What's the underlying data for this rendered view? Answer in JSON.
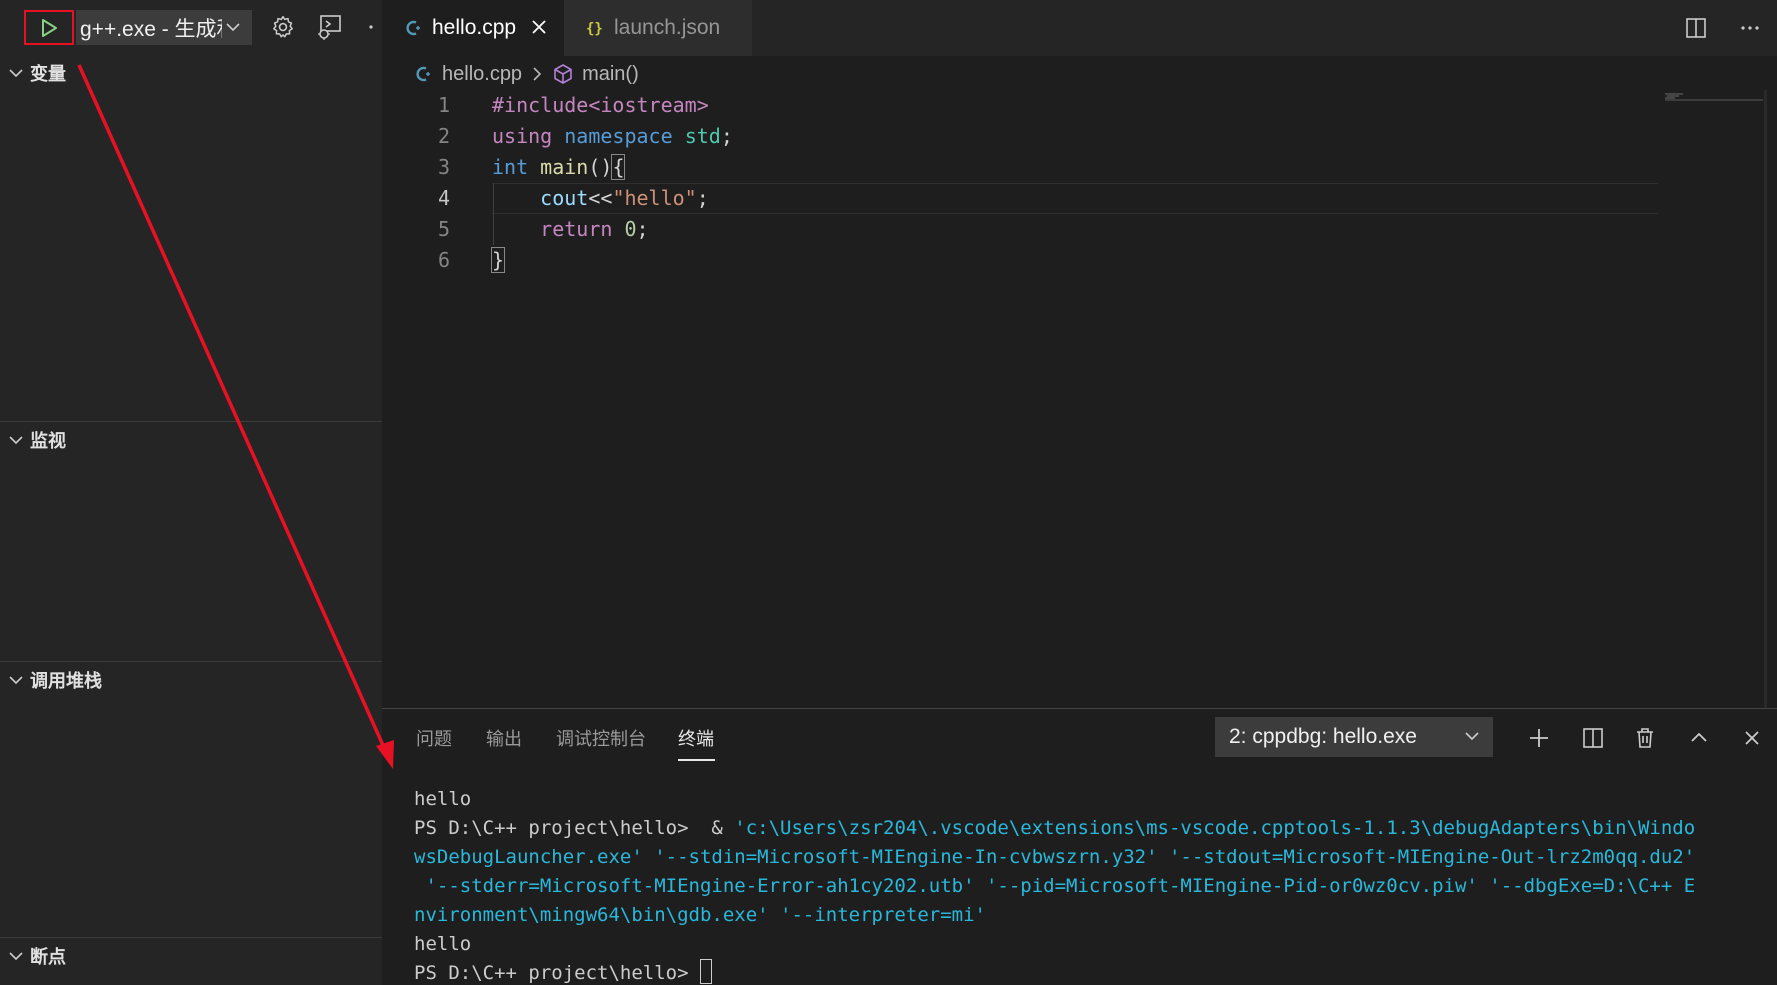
{
  "debug_toolbar": {
    "config_name": "g++.exe - 生成和调试活动文件",
    "icons": [
      "play-icon",
      "gear-icon",
      "debug-console-icon",
      "more-icon"
    ]
  },
  "sidebar": {
    "sections": [
      {
        "label": "变量"
      },
      {
        "label": "监视"
      },
      {
        "label": "调用堆栈"
      },
      {
        "label": "断点"
      }
    ]
  },
  "tabs": [
    {
      "name": "hello.cpp",
      "icon": "cpp-file-icon",
      "active": true
    },
    {
      "name": "launch.json",
      "icon": "json-file-icon",
      "active": false
    }
  ],
  "breadcrumb": {
    "file": "hello.cpp",
    "symbol": "main()"
  },
  "code": {
    "current_line": 4,
    "lines": [
      {
        "number": "1",
        "tokens": [
          {
            "t": "#include<iostream>",
            "c": "kw-purple"
          }
        ]
      },
      {
        "number": "2",
        "tokens": [
          {
            "t": "using",
            "c": "kw-purple"
          },
          {
            "t": " ",
            "c": "punct"
          },
          {
            "t": "namespace",
            "c": "kw-blue"
          },
          {
            "t": " ",
            "c": "punct"
          },
          {
            "t": "std",
            "c": "type"
          },
          {
            "t": ";",
            "c": "punct"
          }
        ]
      },
      {
        "number": "3",
        "tokens": [
          {
            "t": "int",
            "c": "kw-blue"
          },
          {
            "t": " ",
            "c": "punct"
          },
          {
            "t": "main",
            "c": "fn"
          },
          {
            "t": "()",
            "c": "punct"
          },
          {
            "t": "{",
            "c": "bracket-match punct"
          }
        ]
      },
      {
        "number": "4",
        "tokens": [
          {
            "t": "    ",
            "c": "punct"
          },
          {
            "t": "cout",
            "c": "var"
          },
          {
            "t": "<<",
            "c": "punct"
          },
          {
            "t": "\"hello\"",
            "c": "str"
          },
          {
            "t": ";",
            "c": "punct"
          }
        ]
      },
      {
        "number": "5",
        "tokens": [
          {
            "t": "    ",
            "c": "punct"
          },
          {
            "t": "return",
            "c": "kw-purple"
          },
          {
            "t": " ",
            "c": "punct"
          },
          {
            "t": "0",
            "c": "num"
          },
          {
            "t": ";",
            "c": "punct"
          }
        ]
      },
      {
        "number": "6",
        "tokens": [
          {
            "t": "}",
            "c": "bracket-match punct"
          }
        ]
      }
    ]
  },
  "panel": {
    "tabs": [
      {
        "label": "问题",
        "active": false
      },
      {
        "label": "输出",
        "active": false
      },
      {
        "label": "调试控制台",
        "active": false
      },
      {
        "label": "终端",
        "active": true
      }
    ],
    "terminal_selector": "2: cppdbg: hello.exe",
    "terminal_lines": [
      {
        "parts": [
          {
            "t": "hello",
            "c": ""
          }
        ]
      },
      {
        "parts": [
          {
            "t": "PS D:\\C++ project\\hello>  & ",
            "c": ""
          },
          {
            "t": "'c:\\Users\\zsr204\\.vscode\\extensions\\ms-vscode.cpptools-1.1.3\\debugAdapters\\bin\\Windo",
            "c": "cmd"
          }
        ]
      },
      {
        "parts": [
          {
            "t": "wsDebugLauncher.exe' '--stdin=Microsoft-MIEngine-In-cvbwszrn.y32' '--stdout=Microsoft-MIEngine-Out-lrz2m0qq.du2'",
            "c": "cmd"
          }
        ]
      },
      {
        "parts": [
          {
            "t": " '--stderr=Microsoft-MIEngine-Error-ah1cy202.utb' '--pid=Microsoft-MIEngine-Pid-or0wz0cv.piw' '--dbgExe=D:\\C++ E",
            "c": "cmd"
          }
        ]
      },
      {
        "parts": [
          {
            "t": "nvironment\\mingw64\\bin\\gdb.exe' '--interpreter=mi'",
            "c": "cmd"
          }
        ]
      },
      {
        "parts": [
          {
            "t": "hello",
            "c": ""
          }
        ]
      },
      {
        "parts": [
          {
            "t": "PS D:\\C++ project\\hello> ",
            "c": ""
          }
        ],
        "cursor": true
      }
    ]
  },
  "colors": {
    "annotation_red": "#e81123",
    "run_icon_green": "#89d185"
  }
}
